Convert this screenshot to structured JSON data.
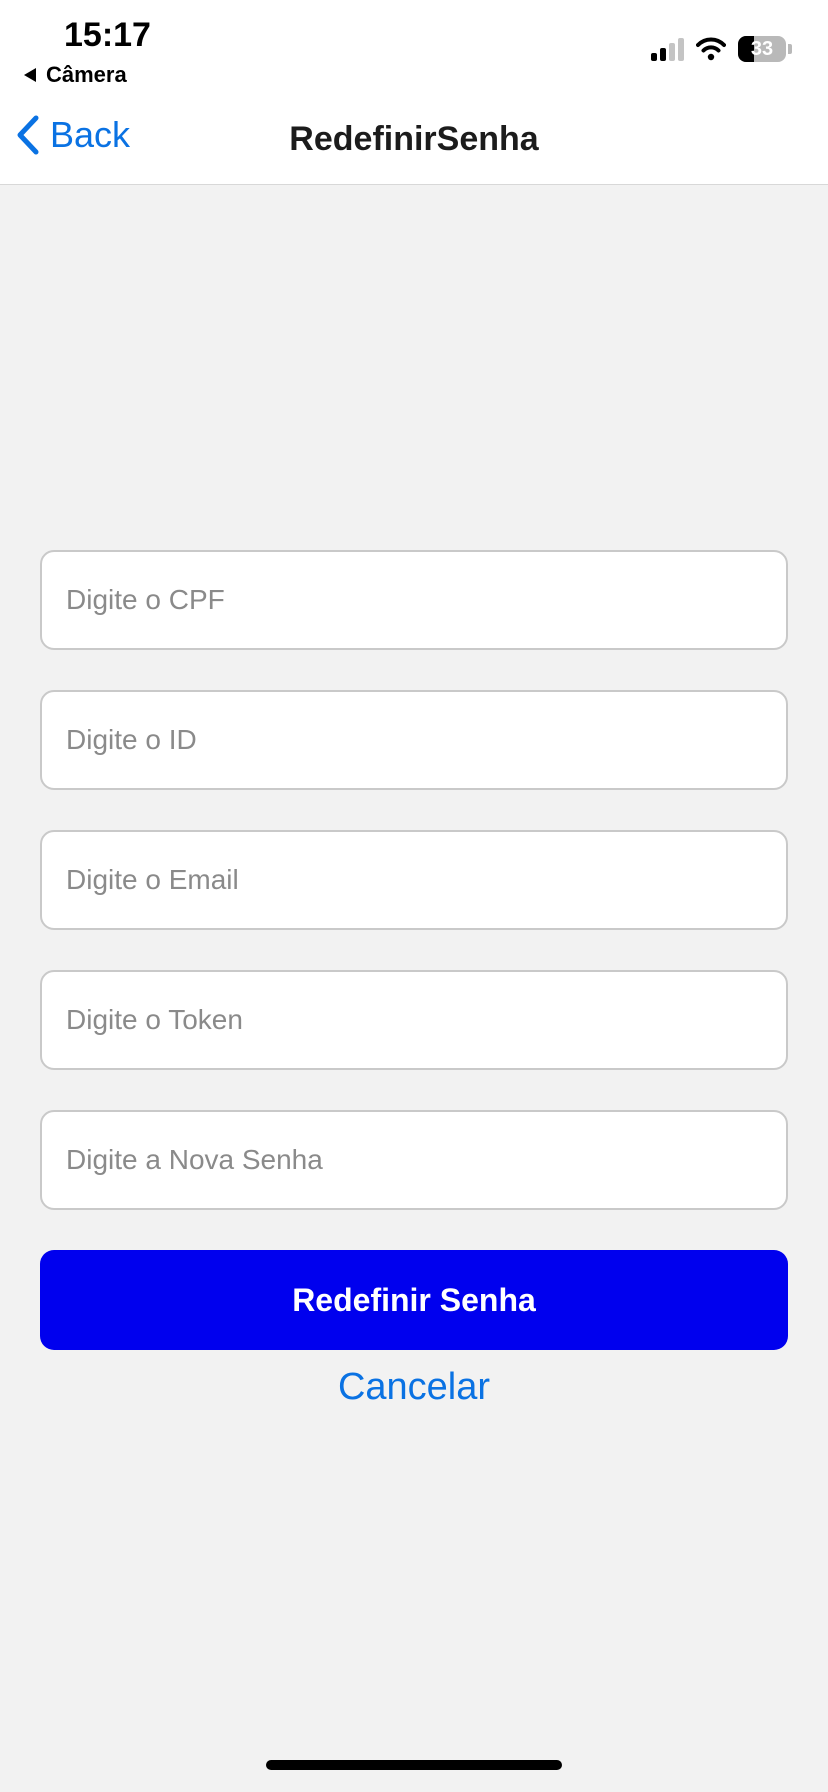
{
  "status_bar": {
    "time": "15:17",
    "back_app_label": "Câmera",
    "battery_level": "33",
    "battery_fraction": 0.33,
    "icons": [
      "signal-icon",
      "wifi-icon",
      "battery-icon"
    ]
  },
  "nav": {
    "back_label": "Back",
    "title": "RedefinirSenha"
  },
  "form": {
    "fields": [
      {
        "placeholder": "Digite o CPF",
        "value": ""
      },
      {
        "placeholder": "Digite o ID",
        "value": ""
      },
      {
        "placeholder": "Digite o Email",
        "value": ""
      },
      {
        "placeholder": "Digite o Token",
        "value": ""
      },
      {
        "placeholder": "Digite a Nova Senha",
        "value": ""
      }
    ],
    "submit_label": "Redefinir Senha",
    "cancel_label": "Cancelar"
  },
  "colors": {
    "accent": "#0a72e3",
    "primary_button": "#0000ee",
    "background": "#f2f2f2"
  }
}
